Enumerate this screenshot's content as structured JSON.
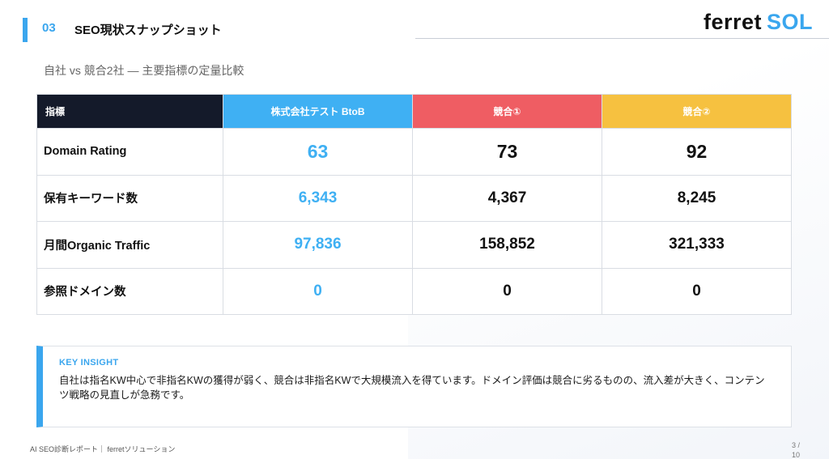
{
  "header": {
    "section_number": "03",
    "section_title": "SEO現状スナップショット",
    "logo_part1": "ferret",
    "logo_part2": "SOL"
  },
  "subtitle": "自社 vs 競合2社 — 主要指標の定量比較",
  "table": {
    "headers": [
      "指標",
      "株式会社テスト BtoB",
      "競合①",
      "競合②"
    ],
    "header_colors": [
      "#141a2a",
      "#3fb0f3",
      "#ef5d63",
      "#f6c140"
    ],
    "rows": [
      {
        "label": "Domain Rating",
        "values": [
          "63",
          "73",
          "92"
        ]
      },
      {
        "label": "保有キーワード数",
        "values": [
          "6,343",
          "4,367",
          "8,245"
        ]
      },
      {
        "label": "月間Organic Traffic",
        "values": [
          "97,836",
          "158,852",
          "321,333"
        ]
      },
      {
        "label": "参照ドメイン数",
        "values": [
          "0",
          "0",
          "0"
        ]
      }
    ]
  },
  "insight": {
    "title": "KEY INSIGHT",
    "text": "自社は指名KW中心で非指名KWの獲得が弱く、競合は非指名KWで大規模流入を得ています。ドメイン評価は競合に劣るものの、流入差が大きく、コンテンツ戦略の見直しが急務です。"
  },
  "footer": {
    "text": "AI SEO診断レポート｜ ferretソリューション",
    "page_current": "3 /",
    "page_total": "10"
  },
  "colors": {
    "accent": "#3aa6ee",
    "competitor1": "#ef5d63",
    "competitor2": "#f6c140",
    "header_dark": "#141a2a"
  }
}
